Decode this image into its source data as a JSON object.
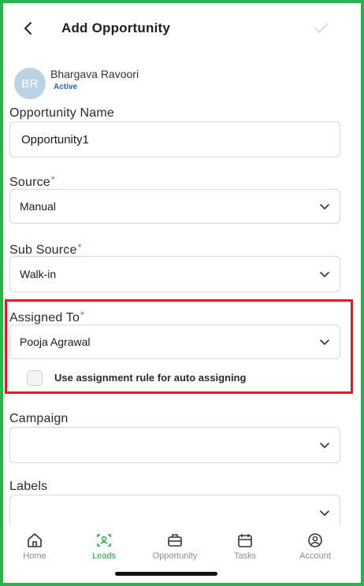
{
  "header": {
    "title": "Add Opportunity"
  },
  "user": {
    "initials": "BR",
    "name": "Bhargava Ravoori",
    "status": "Active"
  },
  "form": {
    "opportunity_name": {
      "label": "Opportunity Name",
      "value": "Opportunity1"
    },
    "source": {
      "label": "Source",
      "value": "Manual",
      "required_mark": "*"
    },
    "sub_source": {
      "label": "Sub Source",
      "value": "Walk-in",
      "required_mark": "*"
    },
    "assigned_to": {
      "label": "Assigned To",
      "value": "Pooja Agrawal",
      "required_mark": "*"
    },
    "auto_assign": {
      "label": "Use assignment rule for auto assigning",
      "checked": false
    },
    "campaign": {
      "label": "Campaign",
      "value": ""
    },
    "labels": {
      "label": "Labels",
      "value": ""
    }
  },
  "nav": {
    "items": [
      {
        "label": "Home",
        "icon": "home-icon"
      },
      {
        "label": "Leads",
        "icon": "leads-icon",
        "active": true
      },
      {
        "label": "Opportunity",
        "icon": "opportunity-icon"
      },
      {
        "label": "Tasks",
        "icon": "tasks-icon"
      },
      {
        "label": "Account",
        "icon": "account-icon"
      }
    ]
  },
  "colors": {
    "accent": "#27a348",
    "highlight": "#e4182b",
    "frame": "#2bb24c",
    "link": "#2b62c8"
  }
}
